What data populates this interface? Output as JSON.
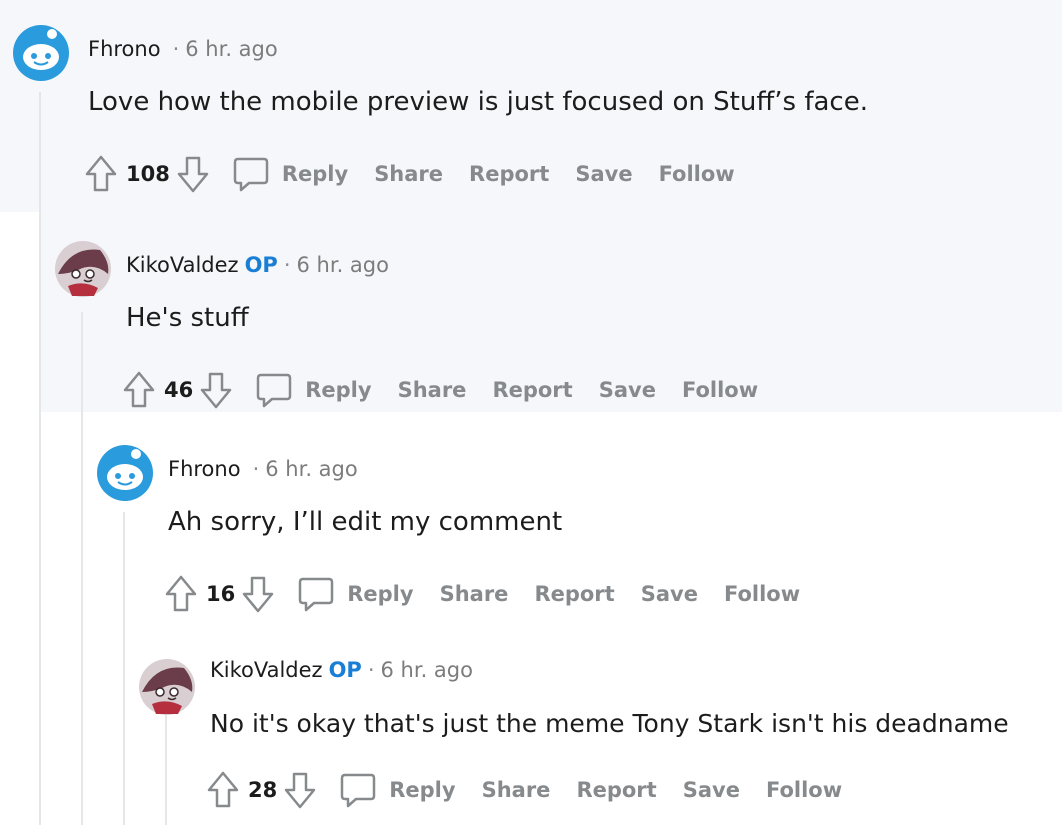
{
  "comments": [
    {
      "username": "Fhrono",
      "op_badge": "",
      "time": "6 hr. ago",
      "body": "Love how the mobile preview is just focused on Stuff’s face.",
      "votes": "108",
      "actions": {
        "reply": "Reply",
        "share": "Share",
        "report": "Report",
        "save": "Save",
        "follow": "Follow"
      },
      "avatar": "snoo-avatar"
    },
    {
      "username": "KikoValdez",
      "op_badge": "OP",
      "time": "6 hr. ago",
      "body": "He's stuff",
      "votes": "46",
      "actions": {
        "reply": "Reply",
        "share": "Share",
        "report": "Report",
        "save": "Save",
        "follow": "Follow"
      },
      "avatar": "character-avatar"
    },
    {
      "username": "Fhrono",
      "op_badge": "",
      "time": "6 hr. ago",
      "body": "Ah sorry, I’ll edit my comment",
      "votes": "16",
      "actions": {
        "reply": "Reply",
        "share": "Share",
        "report": "Report",
        "save": "Save",
        "follow": "Follow"
      },
      "avatar": "snoo-avatar"
    },
    {
      "username": "KikoValdez",
      "op_badge": "OP",
      "time": "6 hr. ago",
      "body": "No it's okay that's just the meme Tony Stark isn't his deadname",
      "votes": "28",
      "actions": {
        "reply": "Reply",
        "share": "Share",
        "report": "Report",
        "save": "Save",
        "follow": "Follow"
      },
      "avatar": "character-avatar"
    }
  ],
  "separator": "·",
  "colors": {
    "highlight_bg": "#f5f7fa",
    "op_blue": "#1a7fd4",
    "action_gray": "#878a8c",
    "thread_line": "#e4e6e8",
    "snoo_blue": "#2a9bdc"
  }
}
